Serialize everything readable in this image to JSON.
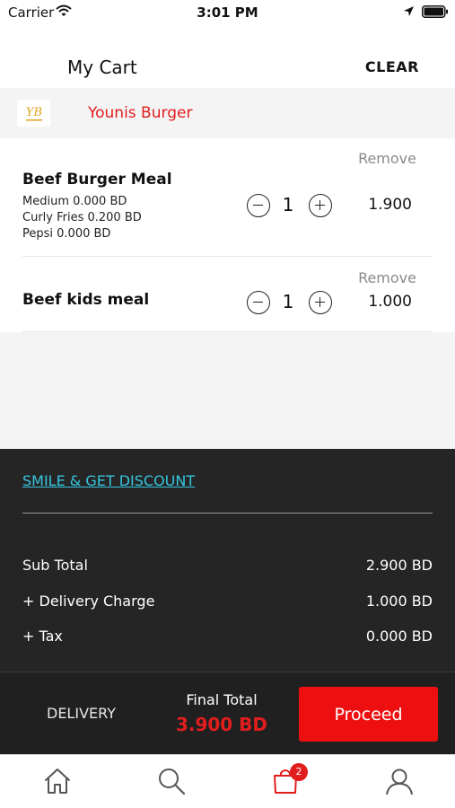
{
  "status_bar": {
    "carrier": "Carrier",
    "time": "3:01 PM"
  },
  "header": {
    "title": "My Cart",
    "clear_label": "CLEAR"
  },
  "restaurant": {
    "name": "Younis Burger",
    "logo_text": "YB"
  },
  "cart": {
    "items": [
      {
        "name": "Beef Burger Meal",
        "options": [
          "Medium  0.000  BD",
          "Curly Fries  0.200  BD",
          "Pepsi  0.000  BD"
        ],
        "quantity": "1",
        "price": "1.900",
        "remove_label": "Remove"
      },
      {
        "name": "Beef kids meal",
        "options": [],
        "quantity": "1",
        "price": "1.000",
        "remove_label": "Remove"
      }
    ]
  },
  "discount": {
    "label": "SMILE & GET DISCOUNT"
  },
  "summary": [
    {
      "label": "Sub Total",
      "value": "2.900 BD"
    },
    {
      "label": "+ Delivery Charge",
      "value": "1.000 BD"
    },
    {
      "label": "+ Tax",
      "value": "0.000 BD"
    }
  ],
  "footer": {
    "delivery_label": "DELIVERY",
    "final_total_label": "Final Total",
    "final_total_value": "3.900 BD",
    "proceed_label": "Proceed"
  },
  "tab_bar": {
    "tabs": [
      "home-icon",
      "search-icon",
      "cart-icon",
      "profile-icon"
    ],
    "cart_badge": "2",
    "active": "cart"
  },
  "colors": {
    "accent_red": "#e11d1d",
    "button_red": "#ee1010",
    "link_cyan": "#35c6df",
    "panel_dark": "#252525"
  }
}
